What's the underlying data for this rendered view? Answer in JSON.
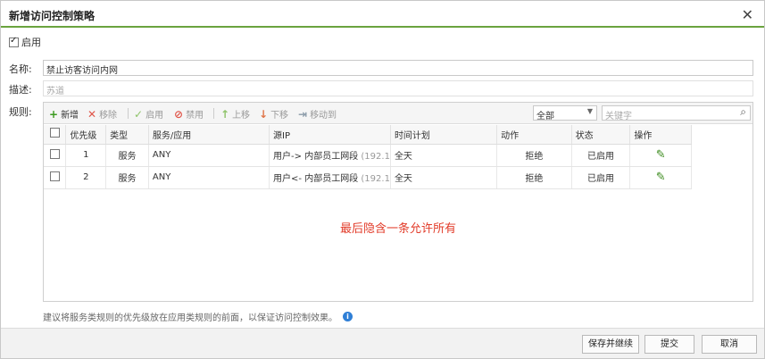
{
  "dialog": {
    "title": "新增访问控制策略",
    "close_icon": "close-icon"
  },
  "enable": {
    "label": "启用",
    "checked": true
  },
  "fields": {
    "name_label": "名称:",
    "name_value": "禁止访客访问内网",
    "desc_label": "描述:",
    "desc_placeholder": "苏道",
    "rules_label": "规则:"
  },
  "toolbar": {
    "add": "新增",
    "delete": "移除",
    "enable": "启用",
    "disable": "禁用",
    "move_up": "上移",
    "move_down": "下移",
    "move_to": "移动到",
    "filter_value": "全部",
    "keyword_placeholder": "关键字"
  },
  "table": {
    "headers": [
      "优先级",
      "类型",
      "服务/应用",
      "源IP",
      "时间计划",
      "动作",
      "状态",
      "操作"
    ],
    "rows": [
      {
        "priority": "1",
        "type": "服务",
        "service": "ANY",
        "src": "用户->",
        "src_group": "内部员工网段",
        "src_ip": "(192.1",
        "schedule": "全天",
        "action": "拒绝",
        "status": "已启用"
      },
      {
        "priority": "2",
        "type": "服务",
        "service": "ANY",
        "src": "用户<-",
        "src_group": "内部员工网段",
        "src_ip": "(192.1",
        "schedule": "全天",
        "action": "拒绝",
        "status": "已启用"
      }
    ]
  },
  "implicit_rule": "最后隐含一条允许所有",
  "hint": "建议将服务类规则的优先级放在应用类规则的前面，以保证访问控制效果。",
  "buttons": {
    "save_continue": "保存并继续",
    "submit": "提交",
    "cancel": "取消"
  },
  "colors": {
    "accent": "#6aa33e",
    "implicit": "#e23c2a",
    "edit": "#3a8a1c"
  }
}
